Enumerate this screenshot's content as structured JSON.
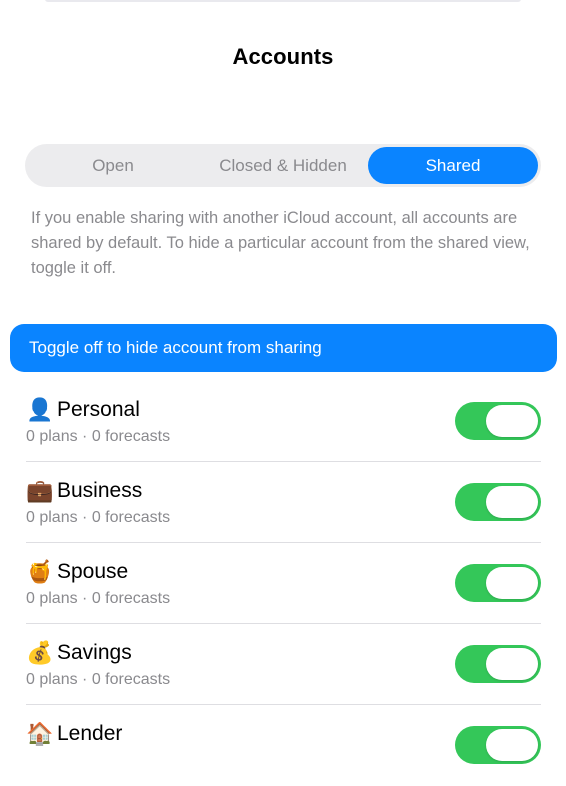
{
  "header": {
    "title": "Accounts"
  },
  "segments": {
    "items": [
      {
        "label": "Open"
      },
      {
        "label": "Closed & Hidden"
      },
      {
        "label": "Shared"
      }
    ],
    "selected": "Shared"
  },
  "info_text": "If you enable sharing with another iCloud account, all accounts are shared by default. To hide a particular account from the shared view, toggle it off.",
  "banner": {
    "text": "Toggle off to hide account from sharing"
  },
  "accounts": [
    {
      "emoji": "👤",
      "icon": "person-silhouette-icon",
      "name": "Personal",
      "subtitle": "0 plans · 0 forecasts",
      "shared": true
    },
    {
      "emoji": "💼",
      "icon": "briefcase-icon",
      "name": "Business",
      "subtitle": "0 plans · 0 forecasts",
      "shared": true
    },
    {
      "emoji": "🍯",
      "icon": "honey-pot-icon",
      "name": "Spouse",
      "subtitle": "0 plans · 0 forecasts",
      "shared": true
    },
    {
      "emoji": "💰",
      "icon": "money-bag-icon",
      "name": "Savings",
      "subtitle": "0 plans · 0 forecasts",
      "shared": true
    },
    {
      "emoji": "🏠",
      "icon": "house-icon",
      "name": "Lender",
      "subtitle": "",
      "shared": true
    }
  ],
  "colors": {
    "accent": "#0a84ff",
    "toggle_on": "#34c759",
    "secondary_text": "#8a8a8e"
  }
}
